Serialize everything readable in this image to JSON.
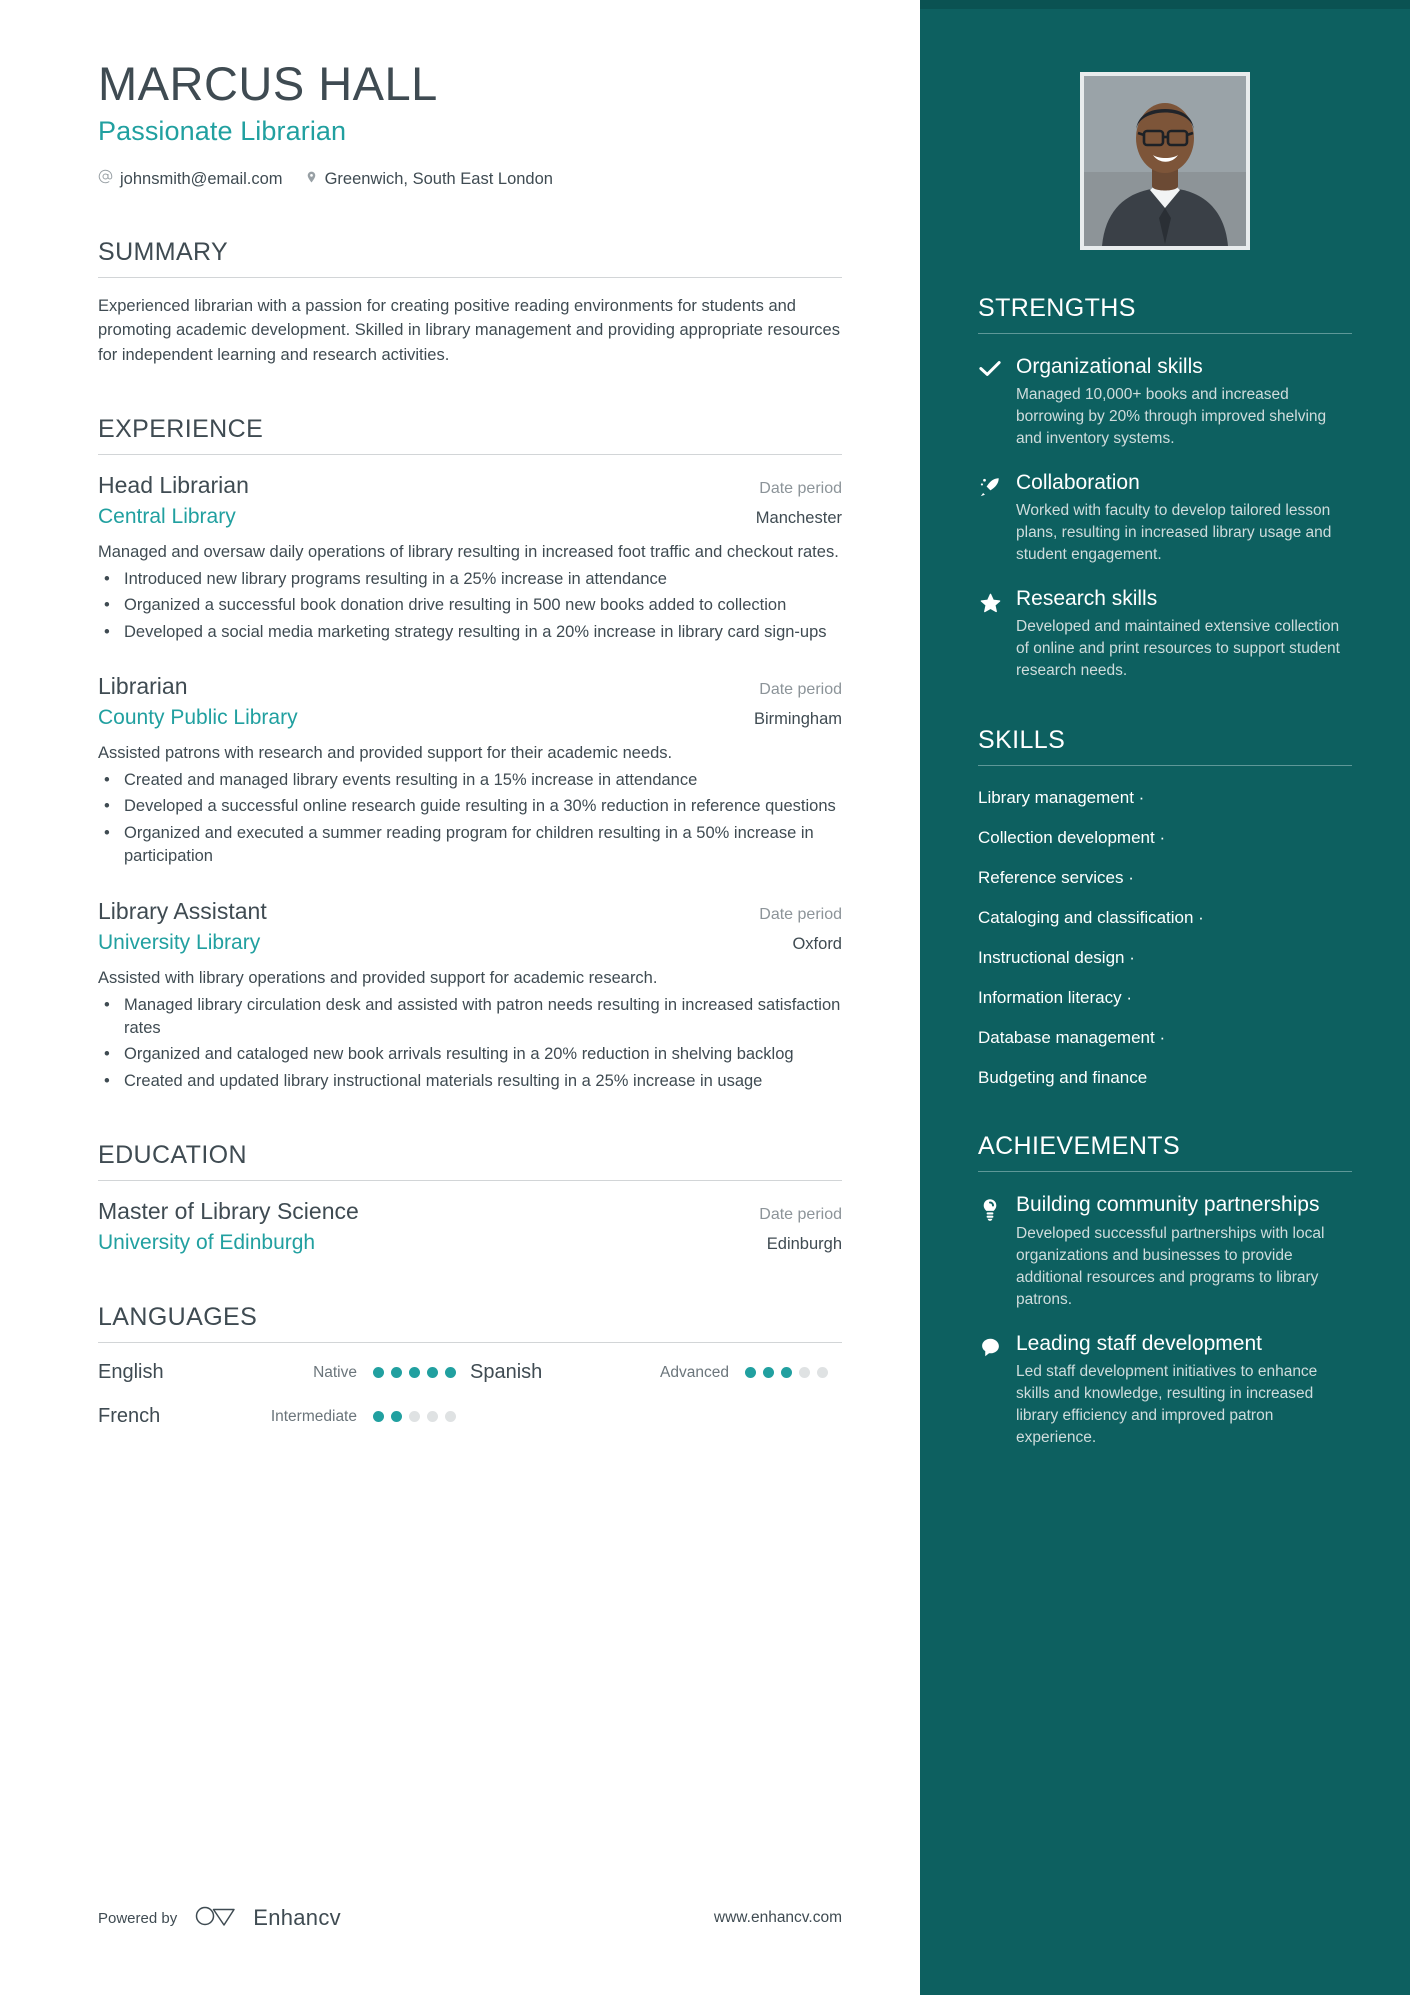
{
  "header": {
    "name": "MARCUS HALL",
    "job_title": "Passionate Librarian",
    "email": "johnsmith@email.com",
    "location": "Greenwich, South East London",
    "email_icon": "at-sign-icon",
    "location_icon": "map-pin-icon"
  },
  "summary": {
    "title": "SUMMARY",
    "text": "Experienced librarian with a passion for creating positive reading environments for students and promoting academic development. Skilled in library management and providing appropriate resources for independent learning and research activities."
  },
  "experience": {
    "title": "EXPERIENCE",
    "entries": [
      {
        "role": "Head Librarian",
        "date": "Date period",
        "org": "Central Library",
        "location": "Manchester",
        "desc": "Managed and oversaw daily operations of library resulting in increased foot traffic and checkout rates.",
        "bullets": [
          "Introduced new library programs resulting in a 25% increase in attendance",
          "Organized a successful book donation drive resulting in 500 new books added to collection",
          "Developed a social media marketing strategy resulting in a 20% increase in library card sign-ups"
        ]
      },
      {
        "role": "Librarian",
        "date": "Date period",
        "org": "County Public Library",
        "location": "Birmingham",
        "desc": "Assisted patrons with research and provided support for their academic needs.",
        "bullets": [
          "Created and managed library events resulting in a 15% increase in attendance",
          "Developed a successful online research guide resulting in a 30% reduction in reference questions",
          "Organized and executed a summer reading program for children resulting in a 50% increase in participation"
        ]
      },
      {
        "role": "Library Assistant",
        "date": "Date period",
        "org": "University Library",
        "location": "Oxford",
        "desc": "Assisted with library operations and provided support for academic research.",
        "bullets": [
          "Managed library circulation desk and assisted with patron needs resulting in increased satisfaction rates",
          "Organized and cataloged new book arrivals resulting in a 20% reduction in shelving backlog",
          "Created and updated library instructional materials resulting in a 25% increase in usage"
        ]
      }
    ]
  },
  "education": {
    "title": "EDUCATION",
    "entries": [
      {
        "degree": "Master of Library Science",
        "date": "Date period",
        "school": "University of Edinburgh",
        "location": "Edinburgh"
      }
    ]
  },
  "languages": {
    "title": "LANGUAGES",
    "max_dots": 5,
    "items": [
      {
        "name": "English",
        "level": "Native",
        "dots": 5
      },
      {
        "name": "Spanish",
        "level": "Advanced",
        "dots": 3
      },
      {
        "name": "French",
        "level": "Intermediate",
        "dots": 2
      }
    ]
  },
  "strengths": {
    "title": "STRENGTHS",
    "items": [
      {
        "icon": "check-icon",
        "title": "Organizational skills",
        "desc": "Managed 10,000+ books and increased borrowing by 20% through improved shelving and inventory systems."
      },
      {
        "icon": "rocket-icon",
        "title": "Collaboration",
        "desc": "Worked with faculty to develop tailored lesson plans, resulting in increased library usage and student engagement."
      },
      {
        "icon": "star-icon",
        "title": "Research skills",
        "desc": "Developed and maintained extensive collection of online and print resources to support student research needs."
      }
    ]
  },
  "skills": {
    "title": "SKILLS",
    "items": [
      "Library management ·",
      "Collection development ·",
      "Reference services ·",
      "Cataloging and classification ·",
      "Instructional design ·",
      "Information literacy ·",
      "Database management ·",
      "Budgeting and finance"
    ]
  },
  "achievements": {
    "title": "ACHIEVEMENTS",
    "items": [
      {
        "icon": "lightbulb-icon",
        "title": "Building community partnerships",
        "desc": "Developed successful partnerships with local organizations and businesses to provide additional resources and programs to library patrons."
      },
      {
        "icon": "speech-bubble-icon",
        "title": "Leading staff development",
        "desc": "Led staff development initiatives to enhance skills and knowledge, resulting in increased library efficiency and improved patron experience."
      }
    ]
  },
  "footer": {
    "powered_by": "Powered by",
    "brand": "Enhancv",
    "url": "www.enhancv.com",
    "logo_icon": "enhancv-logo-icon"
  },
  "colors": {
    "accent_teal": "#21a0a0",
    "sidebar_bg": "#0d6060",
    "text_dark": "#3f4b52",
    "muted": "#8c9499"
  }
}
